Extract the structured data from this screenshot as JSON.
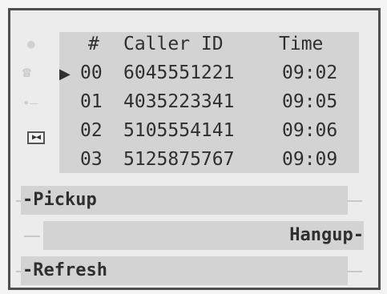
{
  "calls": {
    "headers": {
      "num": "#",
      "caller": "Caller ID",
      "time": "Time"
    },
    "selected_marker": "▶",
    "rows": [
      {
        "num": "00",
        "caller": "6045551221",
        "time": "09:02"
      },
      {
        "num": "01",
        "caller": "4035223341",
        "time": "09:05"
      },
      {
        "num": "02",
        "caller": "5105554141",
        "time": "09:06"
      },
      {
        "num": "03",
        "caller": "5125875767",
        "time": "09:09"
      }
    ],
    "selected_index": 0
  },
  "softkeys": {
    "left_top": "-Pickup",
    "right_mid": "Hangup-",
    "left_bottom": "-Refresh"
  },
  "icons": {
    "dot": "dot-icon",
    "phone": "phone-icon",
    "line": "line-icon",
    "play": "play-pause-icon"
  },
  "colors": {
    "border": "#4f4f4f",
    "panel": "#d3d3d3",
    "background": "#ececec",
    "text": "#2f2f2f"
  }
}
